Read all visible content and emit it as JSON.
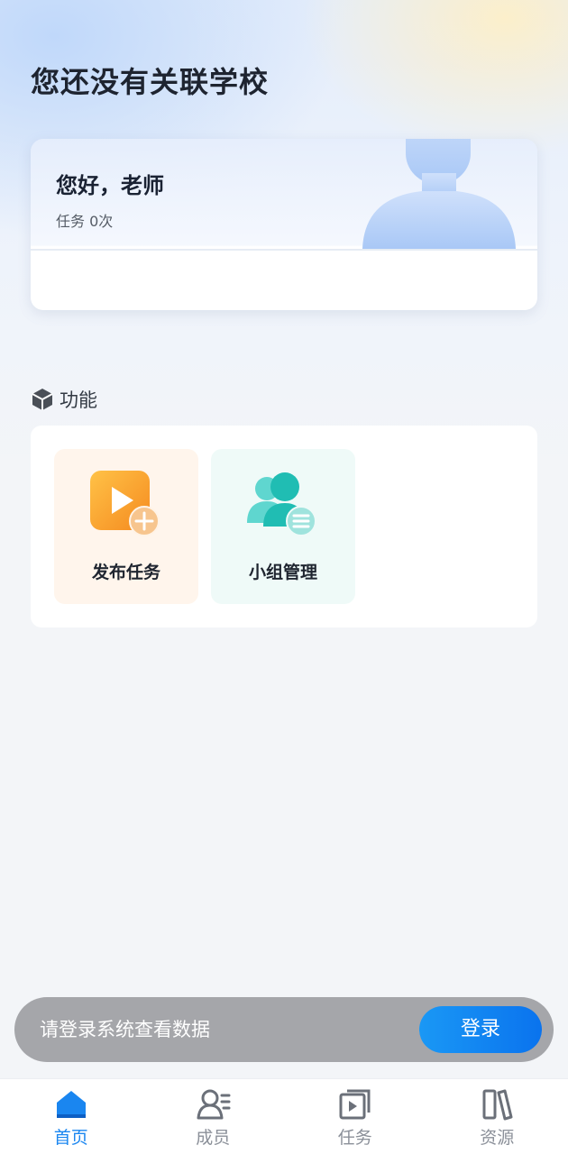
{
  "header": {
    "title": "您还没有关联学校"
  },
  "greeting": {
    "hello": "您好，老师",
    "task_count": "任务 0次"
  },
  "features": {
    "title": "功能",
    "items": [
      {
        "label": "发布任务",
        "icon": "video-add-icon"
      },
      {
        "label": "小组管理",
        "icon": "group-list-icon"
      }
    ]
  },
  "login_banner": {
    "message": "请登录系统查看数据",
    "button": "登录"
  },
  "tabbar": {
    "items": [
      {
        "label": "首页",
        "icon": "home-icon",
        "active": true
      },
      {
        "label": "成员",
        "icon": "members-icon",
        "active": false
      },
      {
        "label": "任务",
        "icon": "task-play-icon",
        "active": false
      },
      {
        "label": "资源",
        "icon": "books-icon",
        "active": false
      }
    ]
  },
  "colors": {
    "accent": "#1a86f0",
    "publish_bg": "#fff5ec",
    "group_bg": "#effaf8",
    "orange": "#f9a52b",
    "teal": "#23c1b8"
  }
}
